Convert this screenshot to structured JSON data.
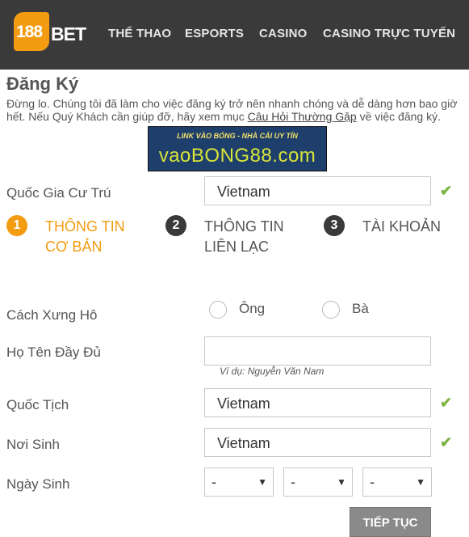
{
  "brand": {
    "logo_badge": "188",
    "logo_text": "BET",
    "accent_color": "#f39c12"
  },
  "nav": [
    "THỂ THAO",
    "ESPORTS",
    "CASINO",
    "CASINO TRỰC TUYẾN"
  ],
  "page": {
    "title": "Đăng Ký",
    "intro_text": "Đừng lo. Chúng tôi đã làm cho việc đăng ký trở nên nhanh chóng và dễ dàng hơn bao giờ hết. Nếu Quý Khách cần giúp đỡ, hãy xem mục ",
    "intro_link": "Câu Hỏi Thường Gặp",
    "intro_tail": " về việc đăng ký."
  },
  "banner": {
    "top": "LINK VÀO BÓNG - NHÀ CÁI UY TÍN",
    "main": "vaoBONG88.com"
  },
  "residence": {
    "label": "Quốc Gia Cư Trú",
    "value": "Vietnam"
  },
  "steps": [
    {
      "num": "1",
      "label": "THÔNG TIN CƠ BẢN",
      "state": "active"
    },
    {
      "num": "2",
      "label": "THÔNG TIN LIÊN LẠC",
      "state": "inactive"
    },
    {
      "num": "3",
      "label": "TÀI KHOẢN",
      "state": "inactive"
    }
  ],
  "salutation": {
    "label": "Cách Xưng Hô",
    "options": [
      "Ông",
      "Bà"
    ]
  },
  "fullname": {
    "label": "Họ Tên Đầy Đủ",
    "value": "",
    "hint": "Ví dụ: Nguyễn Văn Nam"
  },
  "nationality": {
    "label": "Quốc Tịch",
    "value": "Vietnam"
  },
  "birthplace": {
    "label": "Nơi Sinh",
    "value": "Vietnam"
  },
  "birthdate": {
    "label": "Ngày Sinh",
    "day": "-",
    "month": "-",
    "year": "-"
  },
  "next_button": "TIẾP TỤC",
  "colors": {
    "active_step": "#f39c12",
    "inactive_step": "#3a3a3a",
    "valid_check": "#7cb342",
    "header_bg": "#3a3a3a"
  }
}
